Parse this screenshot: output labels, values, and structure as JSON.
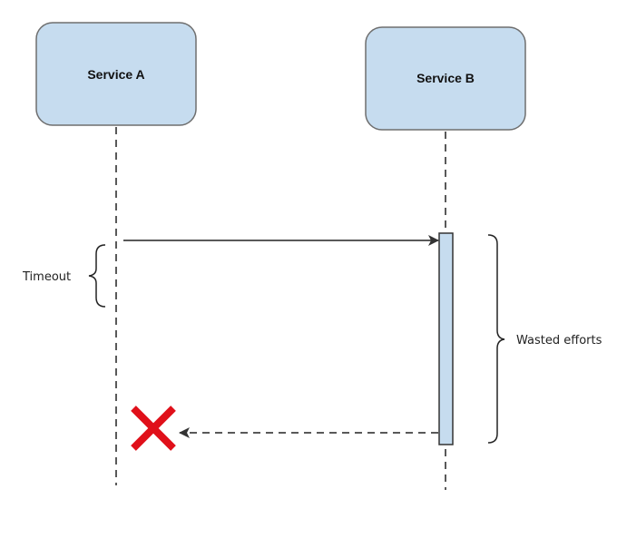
{
  "diagram": {
    "type": "sequence-diagram",
    "participants": [
      {
        "id": "service-a",
        "label": "Service A"
      },
      {
        "id": "service-b",
        "label": "Service B"
      }
    ],
    "messages": [
      {
        "from": "service-a",
        "to": "service-b",
        "style": "solid",
        "kind": "request"
      },
      {
        "from": "service-b",
        "to": "service-a",
        "style": "dashed",
        "kind": "response",
        "delivered": false
      }
    ],
    "annotations": {
      "timeout": {
        "label": "Timeout",
        "participant": "service-a"
      },
      "wasted": {
        "label": "Wasted efforts",
        "participant": "service-b"
      }
    },
    "colors": {
      "participant_fill": "#c6dcef",
      "participant_stroke": "#6e6e6e",
      "activation_fill": "#c6dcef",
      "line": "#222222",
      "failure_mark": "#e0101a"
    },
    "icons": {
      "failure": "red-x-icon"
    }
  }
}
